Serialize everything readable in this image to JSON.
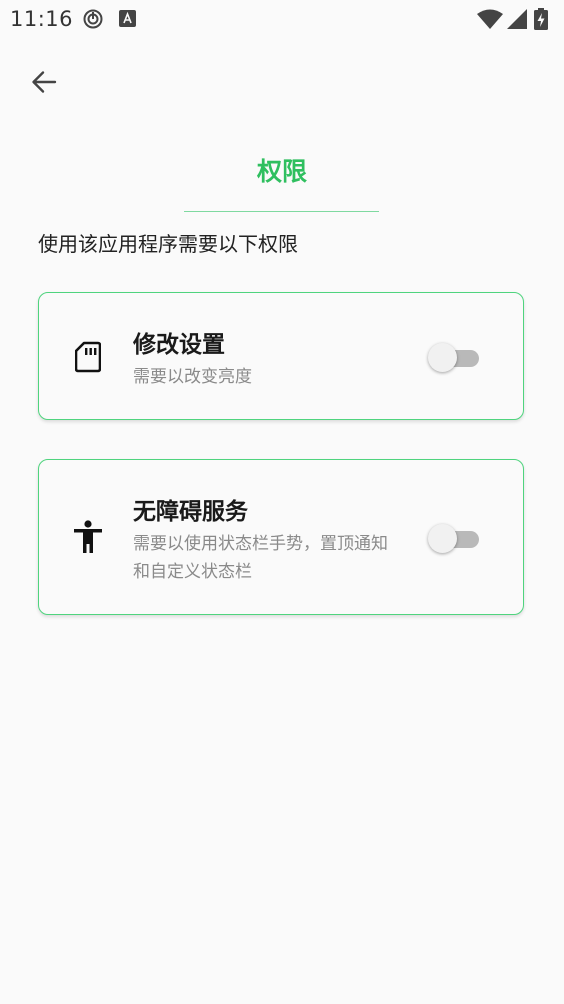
{
  "status_bar": {
    "time": "11:16"
  },
  "header": {
    "back_icon": "arrow-left-icon",
    "title": "权限"
  },
  "description": "使用该应用程序需要以下权限",
  "permissions": [
    {
      "icon": "sd-card-icon",
      "title": "修改设置",
      "subtitle": "需要以改变亮度",
      "enabled": false
    },
    {
      "icon": "accessibility-icon",
      "title": "无障碍服务",
      "subtitle": "需要以使用状态栏手势，置顶通知和自定义状态栏",
      "enabled": false
    }
  ],
  "colors": {
    "accent": "#2fbf5f",
    "card_border": "#4fd47e",
    "background": "#fafafa"
  }
}
